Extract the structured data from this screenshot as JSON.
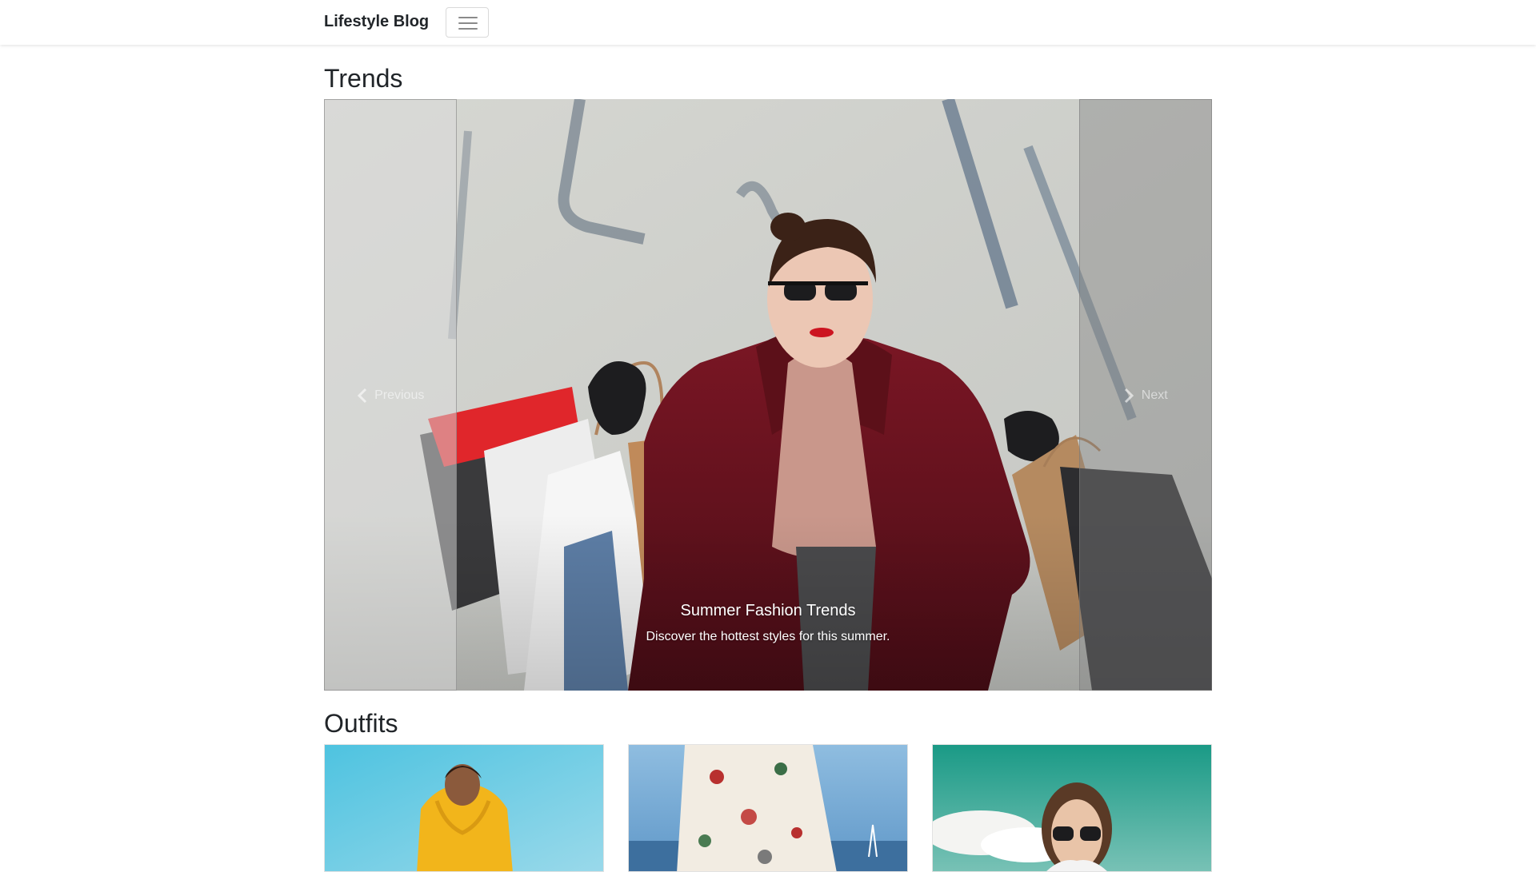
{
  "navbar": {
    "brand": "Lifestyle Blog",
    "toggler_icon": "hamburger-icon"
  },
  "trends": {
    "title": "Trends",
    "carousel": {
      "prev_label": "Previous",
      "next_label": "Next",
      "slide": {
        "title": "Summer Fashion Trends",
        "text": "Discover the hottest styles for this summer."
      }
    }
  },
  "outfits": {
    "title": "Outfits",
    "cards": [
      {
        "photo": "woman-yellow-hoodie-photo"
      },
      {
        "photo": "floral-dress-photo"
      },
      {
        "photo": "woman-sunglasses-photo"
      }
    ]
  },
  "colors": {
    "coat": "#6b1320",
    "sky_blue": "#4ec3e0",
    "teal": "#1a9a86"
  }
}
